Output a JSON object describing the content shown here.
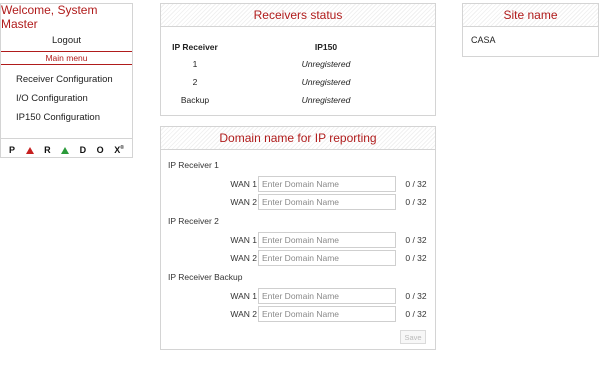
{
  "left_menu": {
    "welcome": "Welcome, System Master",
    "logout": "Logout",
    "main_menu": "Main menu",
    "items": [
      {
        "label": "Receiver Configuration"
      },
      {
        "label": "I/O Configuration"
      },
      {
        "label": "IP150 Configuration"
      }
    ],
    "logo_letters": [
      "P",
      "R",
      "D",
      "O",
      "X"
    ],
    "logo_trademark": "®"
  },
  "receivers_status": {
    "title": "Receivers status",
    "col_receiver": "IP Receiver",
    "col_device": "IP150",
    "rows": [
      {
        "receiver": "1",
        "status": "Unregistered"
      },
      {
        "receiver": "2",
        "status": "Unregistered"
      },
      {
        "receiver": "Backup",
        "status": "Unregistered"
      }
    ]
  },
  "site": {
    "title": "Site name",
    "value": "CASA"
  },
  "domain": {
    "title": "Domain name for IP reporting",
    "groups": [
      {
        "label": "IP Receiver 1",
        "wans": [
          {
            "label": "WAN 1",
            "value": "",
            "placeholder": "Enter Domain Name",
            "count": "0 / 32"
          },
          {
            "label": "WAN 2",
            "value": "",
            "placeholder": "Enter Domain Name",
            "count": "0 / 32"
          }
        ]
      },
      {
        "label": "IP Receiver 2",
        "wans": [
          {
            "label": "WAN 1",
            "value": "",
            "placeholder": "Enter Domain Name",
            "count": "0 / 32"
          },
          {
            "label": "WAN 2",
            "value": "",
            "placeholder": "Enter Domain Name",
            "count": "0 / 32"
          }
        ]
      },
      {
        "label": "IP Receiver Backup",
        "wans": [
          {
            "label": "WAN 1",
            "value": "",
            "placeholder": "Enter Domain Name",
            "count": "0 / 32"
          },
          {
            "label": "WAN 2",
            "value": "",
            "placeholder": "Enter Domain Name",
            "count": "0 / 32"
          }
        ]
      }
    ],
    "save_label": "Save"
  },
  "colors": {
    "accent": "#b01b1b",
    "logo_red": "#c62020",
    "logo_green": "#2a9a3a",
    "border": "#d4d4d4"
  }
}
